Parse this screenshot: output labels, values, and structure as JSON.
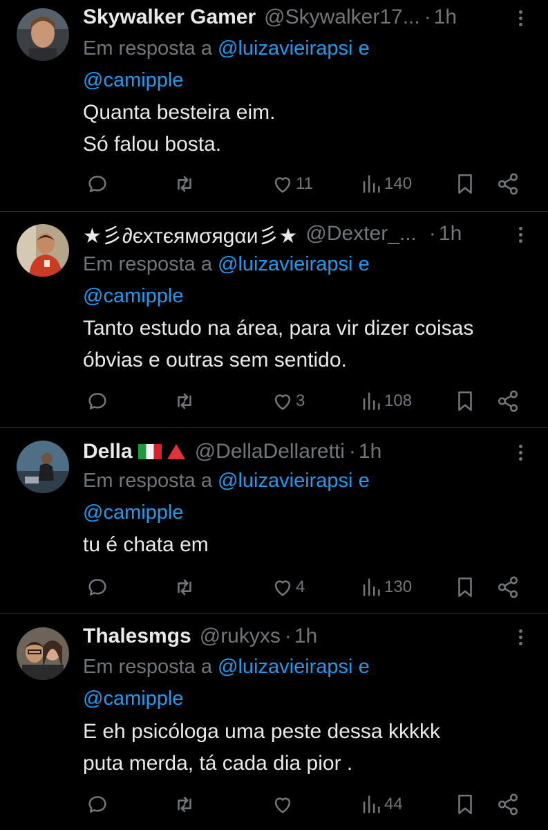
{
  "colors": {
    "background": "#000000",
    "text": "#e7e9ea",
    "muted": "#71767b",
    "link": "#1d9bf0",
    "divider": "#2f3336"
  },
  "tweets": [
    {
      "name": "Skywalker Gamer",
      "handle": "@Skywalker17...",
      "dot": "·",
      "time": "1h",
      "reply_prefix": "Em resposta a",
      "mention1": "@luizavieirapsi",
      "conj": "e",
      "mention2": "@camipple",
      "lines": [
        "Quanta besteira eim.",
        "Só falou bosta."
      ],
      "likes": "11",
      "views": "140",
      "avatar_icon": "avatar-photo"
    },
    {
      "name": "★彡∂єxтєямσяgαи彡★",
      "handle": "@Dexter_...",
      "dot": "·",
      "time": "1h",
      "reply_prefix": "Em resposta a",
      "mention1": "@luizavieirapsi",
      "conj": "e",
      "mention2": "@camipple",
      "lines": [
        "Tanto estudo na área, para vir dizer coisas",
        "óbvias e outras sem sentido."
      ],
      "likes": "3",
      "views": "108",
      "avatar_icon": "avatar-photo"
    },
    {
      "name": "Della",
      "handle": "@DellaDellaretti",
      "dot": "·",
      "time": "1h",
      "reply_prefix": "Em resposta a",
      "mention1": "@luizavieirapsi",
      "conj": "e",
      "mention2": "@camipple",
      "lines": [
        "tu é chata em"
      ],
      "likes": "4",
      "views": "130",
      "flag_icons": [
        "italy-flag-icon",
        "red-triangle-icon"
      ],
      "avatar_icon": "avatar-photo"
    },
    {
      "name": "Thalesmgs",
      "handle": "@rukyxs",
      "dot": "·",
      "time": "1h",
      "reply_prefix": "Em resposta a",
      "mention1": "@luizavieirapsi",
      "conj": "e",
      "mention2": "@camipple",
      "lines": [
        "E eh psicóloga uma peste dessa kkkkk",
        "puta merda, tá cada dia pior ."
      ],
      "likes": "",
      "views": "44",
      "avatar_icon": "avatar-photo"
    }
  ]
}
